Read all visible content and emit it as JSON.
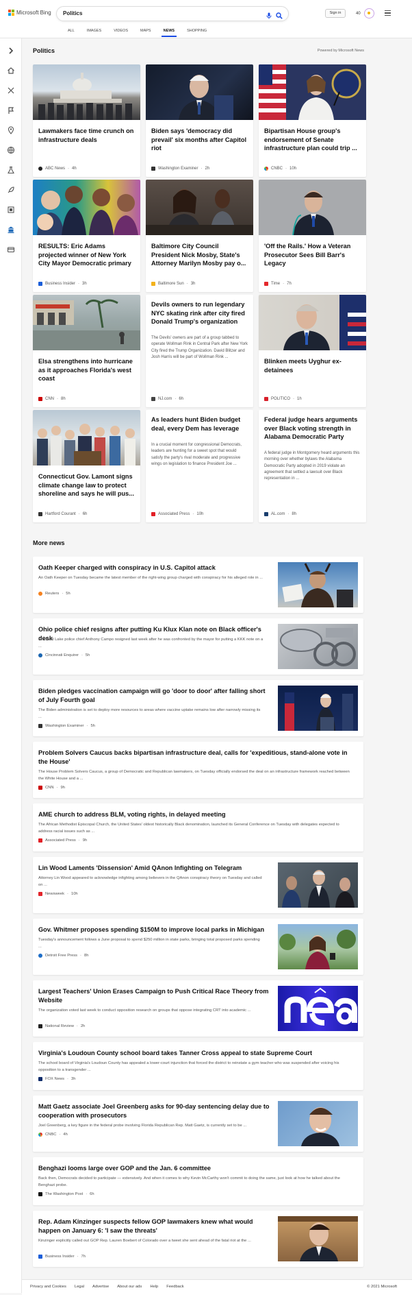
{
  "header": {
    "brand": "Microsoft Bing",
    "query": "Politics",
    "tabs": [
      {
        "label": "ALL"
      },
      {
        "label": "IMAGES"
      },
      {
        "label": "VIDEOS"
      },
      {
        "label": "MAPS"
      },
      {
        "label": "NEWS",
        "active": true
      },
      {
        "label": "SHOPPING"
      }
    ],
    "sign_in": "Sign in",
    "points": "40"
  },
  "colors": {
    "accent": "#174ae4",
    "ms_red": "#f25022",
    "ms_green": "#7fba00",
    "ms_blue": "#00a4ef",
    "ms_yellow": "#ffb900"
  },
  "sidebar": {
    "icons": [
      "chevron-right-icon",
      "home-icon",
      "sports-icon",
      "flag-icon",
      "location-icon",
      "globe-icon",
      "science-icon",
      "rocket-icon",
      "film-icon",
      "bank-icon",
      "credit-card-icon"
    ]
  },
  "politics": {
    "title": "Politics",
    "powered_by": "Powered by Microsoft News",
    "cards": [
      {
        "headline": "Lawmakers face time crunch on infrastructure deals",
        "source": "ABC News",
        "age": "4h",
        "image": "capitol-photo"
      },
      {
        "headline": "Biden says 'democracy did prevail' six months after Capitol riot",
        "source": "Washington Examiner",
        "age": "2h",
        "image": "biden-photo"
      },
      {
        "headline": "Bipartisan House group's endorsement of Senate infrastructure plan could trip ...",
        "source": "CNBC",
        "age": "10h",
        "image": "pelosi-photo"
      },
      {
        "headline": "RESULTS: Eric Adams projected winner of New York City Mayor Democratic primary",
        "source": "Business Insider",
        "age": "3h",
        "image": "candidates-collage"
      },
      {
        "headline": "Baltimore City Council President Nick Mosby, State's Attorney Marilyn Mosby pay o...",
        "source": "Baltimore Sun",
        "age": "3h",
        "image": "mosby-photo"
      },
      {
        "headline": "'Off the Rails.' How a Veteran Prosecutor Sees Bill Barr's Legacy",
        "source": "Time",
        "age": "7h",
        "image": "prosecutor-photo"
      },
      {
        "headline": "Elsa strengthens into hurricane as it approaches Florida's west coast",
        "source": "CNN",
        "age": "8h",
        "image": "storm-photo"
      },
      {
        "headline": "Devils owners to run legendary NYC skating rink after city fired Donald Trump's organization",
        "snippet": "The Devils' owners are part of a group tabbed to operate Wollman Rink in Central Park after New York City fired the Trump Organization. David Blitzer and Josh Harris will be part of Wollman Rink ...",
        "source": "NJ.com",
        "age": "6h"
      },
      {
        "headline": "Blinken meets Uyghur ex-detainees",
        "source": "POLITICO",
        "age": "1h",
        "image": "blinken-photo"
      },
      {
        "headline": "Connecticut Gov. Lamont signs climate change law to protect shoreline and says he will pus...",
        "source": "Hartford Courant",
        "age": "6h",
        "image": "lamont-photo"
      },
      {
        "headline": "As leaders hunt Biden budget deal, every Dem has leverage",
        "snippet": "In a crucial moment for congressional Democrats, leaders are hunting for a sweet spot that would satisfy the party's rival moderate and progressive wings on legislation to finance President Joe ...",
        "source": "Associated Press",
        "age": "10h"
      },
      {
        "headline": "Federal judge hears arguments over Black voting strength in Alabama Democratic Party",
        "snippet": "A federal judge in Montgomery heard arguments this morning over whether bylaws the Alabama Democratic Party adopted in 2019 violate an agreement that settled a lawsuit over Black representation in ...",
        "source": "AL.com",
        "age": "8h"
      }
    ]
  },
  "more_news": {
    "title": "More news",
    "items": [
      {
        "headline": "Oath Keeper charged with conspiracy in U.S. Capitol attack",
        "snippet": "An Oath Keeper on Tuesday became the latest member of the right-wing group charged with conspiracy for his alleged role in ...",
        "source": "Reuters",
        "age": "5h",
        "image": "rioter-photo"
      },
      {
        "headline": "Ohio police chief resigns after putting Ku Klux Klan note on Black officer's desk",
        "snippet": "Sheffield Lake police chief Anthony Campo resigned last week after he was confronted by the mayor for putting a KKK note on a ...",
        "source": "Cincinnati Enquirer",
        "age": "5h",
        "image": "badge-photo"
      },
      {
        "headline": "Biden pledges vaccination campaign will go 'door to door' after falling short of July Fourth goal",
        "snippet": "The Biden administration is set to deploy more resources to areas where vaccine uptake remains low after narrowly missing its ...",
        "source": "Washington Examiner",
        "age": "5h",
        "image": "podium-photo"
      },
      {
        "headline": "Problem Solvers Caucus backs bipartisan infrastructure deal, calls for 'expeditious, stand-alone vote in the House'",
        "snippet": "The House Problem Solvers Caucus, a group of Democratic and Republican lawmakers, on Tuesday officially endorsed the deal on an infrastructure framework reached between the White House and a ...",
        "source": "CNN",
        "age": "9h"
      },
      {
        "headline": "AME church to address BLM, voting rights, in delayed meeting",
        "snippet": "The African Methodist Episcopal Church, the United States' oldest historically Black denomination, launched its General Conference on Tuesday with delegates expected to address racial issues such as ...",
        "source": "Associated Press",
        "age": "9h"
      },
      {
        "headline": "Lin Wood Laments 'Dissension' Amid QAnon Infighting on Telegram",
        "snippet": "Attorney Lin Wood appeared to acknowledge infighting among believers in the QAnon conspiracy theory on Tuesday and called on ...",
        "source": "Newsweek",
        "age": "10h",
        "image": "lin-wood-photo"
      },
      {
        "headline": "Gov. Whitmer proposes spending $150M to improve local parks in Michigan",
        "snippet": "Tuesday's announcement follows a June proposal to spend $250 million in state parks, bringing total proposed parks spending ...",
        "source": "Detroit Free Press",
        "age": "8h",
        "image": "whitmer-photo"
      },
      {
        "headline": "Largest Teachers' Union Erases Campaign to Push Critical Race Theory from Website",
        "snippet": "The organization voted last week to conduct opposition research on groups that oppose integrating CRT into academic ...",
        "source": "National Review",
        "age": "2h",
        "image": "nea-logo-photo"
      },
      {
        "headline": "Virginia's Loudoun County school board takes Tanner Cross appeal to state Supreme Court",
        "snippet": "The school board of Virginia's Loudoun County has appealed a lower-court injunction that forced the district to reinstate a gym teacher who was suspended after voicing his opposition to a transgender ...",
        "source": "FOX News",
        "age": "3h"
      },
      {
        "headline": "Matt Gaetz associate Joel Greenberg asks for 90-day sentencing delay due to cooperation with prosecutors",
        "snippet": "Joel Greenberg, a key figure in the federal probe involving Florida Republican Rep. Matt Gaetz, is currently set to be ...",
        "source": "CNBC",
        "age": "4h",
        "image": "gaetz-photo"
      },
      {
        "headline": "Benghazi looms large over GOP and the Jan. 6 committee",
        "snippet": "Back then, Democrats decided to participate — extensively. And when it comes to why Kevin McCarthy won't commit to doing the same, just look at how he talked about the Benghazi probe.",
        "source": "The Washington Post",
        "age": "6h"
      },
      {
        "headline": "Rep. Adam Kinzinger suspects fellow GOP lawmakers knew what would happen on January 6: 'I saw the threats'",
        "snippet": "Kinzinger explicitly called out GOP Rep. Lauren Boebert of Colorado over a tweet she sent ahead of the fatal riot at the ...",
        "source": "Business Insider",
        "age": "7h",
        "image": "kinzinger-photo"
      }
    ]
  },
  "footer": {
    "links": [
      "Privacy and Cookies",
      "Legal",
      "Advertise",
      "About our ads",
      "Help",
      "Feedback"
    ],
    "copyright": "© 2021 Microsoft"
  }
}
